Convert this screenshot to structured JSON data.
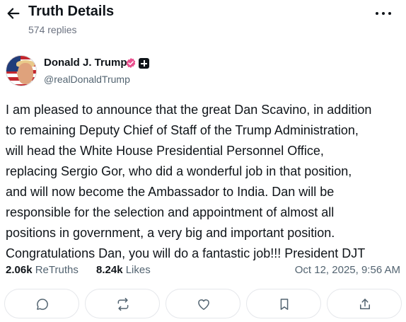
{
  "header": {
    "title": "Truth Details",
    "replies": "574 replies"
  },
  "author": {
    "display_name": "Donald J. Trump",
    "handle": "@realDonaldTrump"
  },
  "post": {
    "lines": [
      "I am pleased to announce that the great Dan Scavino, in addition",
      "to remaining Deputy Chief of Staff of the Trump Administration,",
      "will head the White House Presidential Personnel Office,",
      "replacing Sergio Gor, who did a wonderful job in that position,",
      "and will now become the Ambassador to India. Dan will be",
      "responsible for the selection and appointment of almost all",
      "positions in government, a very big and important position.",
      "Congratulations Dan, you will do a fantastic job!!! President DJT"
    ]
  },
  "stats": {
    "retruths_count": "2.06k",
    "retruths_label": "ReTruths",
    "likes_count": "8.24k",
    "likes_label": "Likes",
    "timestamp": "Oct 12, 2025, 9:56 AM"
  },
  "icons": {
    "back": "arrow-left-icon",
    "more": "more-horizontal-icon",
    "verified": "verified-badge-icon",
    "plus": "plus-badge-icon",
    "reply": "comment-icon",
    "retruth": "repost-icon",
    "like": "heart-icon",
    "bookmark": "bookmark-icon",
    "share": "share-icon"
  },
  "colors": {
    "verified_badge": "#e8508e",
    "text_primary": "#0f1419",
    "text_secondary": "#536471",
    "button_border": "#e5e7eb"
  }
}
